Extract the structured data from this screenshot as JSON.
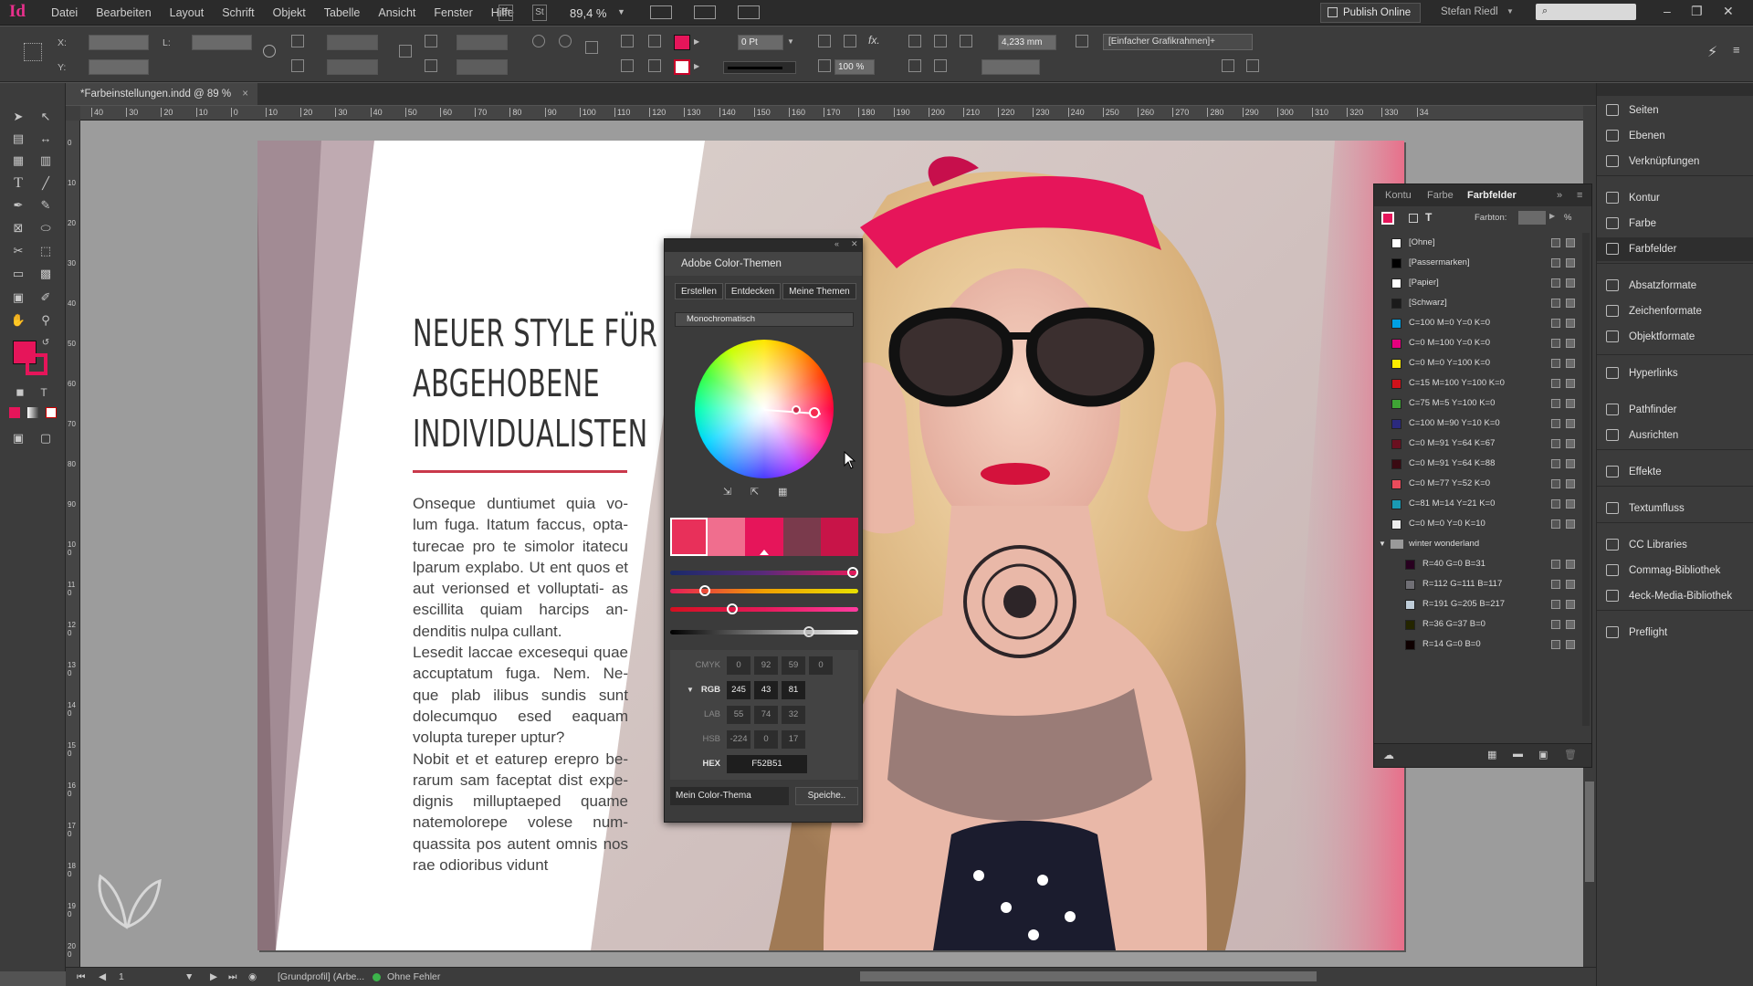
{
  "app": {
    "logo": "Id",
    "zoom": "89,4 %",
    "publish": "Publish Online",
    "user": "Stefan Riedl",
    "bridge": "Br",
    "stock": "St"
  },
  "menu": [
    "Datei",
    "Bearbeiten",
    "Layout",
    "Schrift",
    "Objekt",
    "Tabelle",
    "Ansicht",
    "Fenster",
    "Hilfe"
  ],
  "control": {
    "x_label": "X:",
    "y_label": "Y:",
    "w_label": "L:",
    "stroke_weight": "0 Pt",
    "stroke_width_mm": "4,233 mm",
    "scale": "100 %",
    "frame_style": "[Einfacher Grafikrahmen]+"
  },
  "document": {
    "tab": "*Farbeinstellungen.indd @ 89 %",
    "close": "×"
  },
  "ruler_h": [
    "40",
    "30",
    "20",
    "10",
    "0",
    "10",
    "20",
    "30",
    "40",
    "50",
    "60",
    "70",
    "80",
    "90",
    "100",
    "110",
    "120",
    "130",
    "140",
    "150",
    "160",
    "170",
    "180",
    "190",
    "200",
    "210",
    "220",
    "230",
    "240",
    "250",
    "260",
    "270",
    "280",
    "290",
    "300",
    "310",
    "320",
    "330",
    "34"
  ],
  "ruler_v": [
    "0",
    "10",
    "20",
    "30",
    "40",
    "50",
    "60",
    "70",
    "80",
    "90",
    "100",
    "110",
    "120",
    "130",
    "140",
    "150",
    "160",
    "170",
    "180",
    "190",
    "200"
  ],
  "page": {
    "headline": [
      "NEUER STYLE FÜR",
      "ABGEHOBENE",
      "INDIVIDUALISTEN"
    ],
    "body": [
      "Onseque duntiumet quia vo- lum fuga. Itatum faccus, opta- turecae pro te simolor itatecu lparum explabo. Ut ent quos et aut verionsed et volluptati- as escillita quiam harcips an- denditis nulpa cullant.",
      "Lesedit laccae excesequi quae accuptatum fuga. Nem. Ne- que plab ilibus sundis sunt dolecumquo esed eaquam volupta tureper uptur?",
      "Nobit et et eaturep erepro be- rarum sam faceptat dist expe- dignis milluptaeped quame natemolorepe volese num- quassita pos autent omnis nos rae odioribus vidunt"
    ]
  },
  "color_themes": {
    "title": "Adobe Color-Themen",
    "tabs": [
      "Erstellen",
      "Entdecken",
      "Meine Themen"
    ],
    "rule": "Monochromatisch",
    "swatches": [
      "#e8305a",
      "#f06e8e",
      "#e6155a",
      "#7a3a4c",
      "#c81448"
    ],
    "modes": {
      "cmyk": {
        "label": "CMYK",
        "values": [
          "0",
          "92",
          "59",
          "0"
        ]
      },
      "rgb": {
        "label": "RGB",
        "values": [
          "245",
          "43",
          "81"
        ]
      },
      "lab": {
        "label": "LAB",
        "values": [
          "55",
          "74",
          "32"
        ]
      },
      "hsb": {
        "label": "HSB",
        "values": [
          "-224",
          "0",
          "17"
        ]
      },
      "hex": {
        "label": "HEX",
        "value": "F52B51"
      }
    },
    "theme_name": "Mein Color-Thema",
    "save": "Speiche.."
  },
  "swatches_panel": {
    "tabs": [
      "Kontu",
      "Farbe",
      "Farbfelder"
    ],
    "tint_label": "Farbton:",
    "tint_unit": "%",
    "items": [
      {
        "name": "[Ohne]",
        "color": "#ffffff"
      },
      {
        "name": "[Passermarken]",
        "color": "#000000"
      },
      {
        "name": "[Papier]",
        "color": "#ffffff"
      },
      {
        "name": "[Schwarz]",
        "color": "#1a1a1a"
      },
      {
        "name": "C=100 M=0 Y=0 K=0",
        "color": "#00a0e3"
      },
      {
        "name": "C=0 M=100 Y=0 K=0",
        "color": "#e5007e"
      },
      {
        "name": "C=0 M=0 Y=100 K=0",
        "color": "#ffed00"
      },
      {
        "name": "C=15 M=100 Y=100 K=0",
        "color": "#d0121b"
      },
      {
        "name": "C=75 M=5 Y=100 K=0",
        "color": "#3fa535"
      },
      {
        "name": "C=100 M=90 Y=10 K=0",
        "color": "#2b2a7e"
      },
      {
        "name": "C=0 M=91 Y=64 K=67",
        "color": "#6a1020"
      },
      {
        "name": "C=0 M=91 Y=64 K=88",
        "color": "#3a0a12"
      },
      {
        "name": "C=0 M=77 Y=52 K=0",
        "color": "#e94b5b"
      },
      {
        "name": "C=81 M=14 Y=21 K=0",
        "color": "#1a9ab3"
      },
      {
        "name": "C=0 M=0 Y=0 K=10",
        "color": "#ececec"
      }
    ],
    "group": "winter wonderland",
    "group_items": [
      {
        "name": "R=40 G=0 B=31",
        "color": "#28001f"
      },
      {
        "name": "R=112 G=111 B=117",
        "color": "#706f75"
      },
      {
        "name": "R=191 G=205 B=217",
        "color": "#bfcdd9"
      },
      {
        "name": "R=36 G=37 B=0",
        "color": "#242500"
      },
      {
        "name": "R=14 G=0 B=0",
        "color": "#0e0000"
      }
    ]
  },
  "right_panel": [
    {
      "label": "Seiten"
    },
    {
      "label": "Ebenen"
    },
    {
      "label": "Verknüpfungen"
    },
    {
      "label": "Kontur"
    },
    {
      "label": "Farbe"
    },
    {
      "label": "Farbfelder"
    },
    {
      "label": "Absatzformate"
    },
    {
      "label": "Zeichenformate"
    },
    {
      "label": "Objektformate"
    },
    {
      "label": "Hyperlinks"
    },
    {
      "label": "Pathfinder"
    },
    {
      "label": "Ausrichten"
    },
    {
      "label": "Effekte"
    },
    {
      "label": "Textumfluss"
    },
    {
      "label": "CC Libraries"
    },
    {
      "label": "Commag-Bibliothek"
    },
    {
      "label": "4eck-Media-Bibliothek"
    },
    {
      "label": "Preflight"
    }
  ],
  "status": {
    "page": "1",
    "profile": "[Grundprofil] (Arbe...",
    "errors": "Ohne Fehler"
  },
  "colors": {
    "accent": "#F52B51",
    "fill": "#e6155a"
  }
}
